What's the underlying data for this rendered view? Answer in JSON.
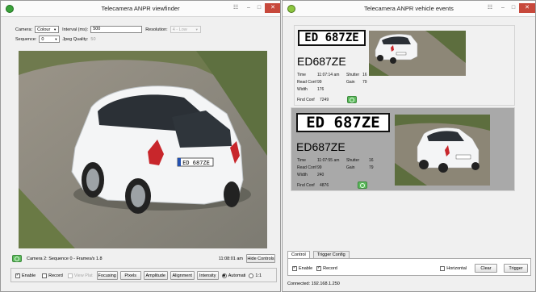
{
  "viewfinder": {
    "title": "Telecamera ANPR viewfinder",
    "controls": {
      "camera_label": "Camera:",
      "camera_value": "Colour",
      "interval_label": "Interval (ms):",
      "interval_value": "500",
      "resolution_label": "Resolution:",
      "resolution_value": "4 - Low",
      "sequence_label": "Sequence:",
      "sequence_value": "0",
      "jpeg_label": "Jpeg Quality:",
      "jpeg_value": "50"
    },
    "image_plate": "ED 687ZE",
    "status": {
      "text": "Camera 2: Sequence 0 - Frames/s 1.8",
      "time": "11:08:01 am",
      "hide_controls": "Hide Controls"
    },
    "toolbar": {
      "enable": "Enable",
      "enable_checked": true,
      "record": "Record",
      "record_checked": false,
      "view_plat": "View Plat",
      "focusing": "Focusing",
      "pixels": "Pixels",
      "amplitude": "Amplitude",
      "alignment": "Alignment",
      "intensity": "Intensity",
      "automatic": "Automati",
      "one_to_one": "1:1"
    }
  },
  "events_window": {
    "title": "Telecamera ANPR vehicle events",
    "events": [
      {
        "plate_crop": "ED 687ZE",
        "plate": "ED687ZE",
        "time_label": "Time",
        "time": "11:07:14 am",
        "shutter_label": "Shutter",
        "shutter": "16",
        "read_conf_label": "Read Conf",
        "read_conf": "99",
        "gain_label": "Gain",
        "gain": "79",
        "width_label": "Width",
        "width": "176",
        "find_conf_label": "Find Conf",
        "find_conf": "7249"
      },
      {
        "plate_crop": "ED 687ZE",
        "plate": "ED687ZE",
        "time_label": "Time",
        "time": "11:07:55 am",
        "shutter_label": "Shutter",
        "shutter": "16",
        "read_conf_label": "Read Conf",
        "read_conf": "99",
        "gain_label": "Gain",
        "gain": "79",
        "width_label": "Width",
        "width": "240",
        "find_conf_label": "Find Conf",
        "find_conf": "4876"
      }
    ],
    "tabs": [
      "Control",
      "Trigger Config"
    ],
    "control": {
      "enable": "Enable",
      "enable_checked": true,
      "record": "Record",
      "record_checked": true,
      "horizontal": "Horizontal",
      "horizontal_checked": false,
      "clear": "Clear",
      "trigger": "Trigger"
    },
    "status": "Connected: 192.168.1.250"
  }
}
